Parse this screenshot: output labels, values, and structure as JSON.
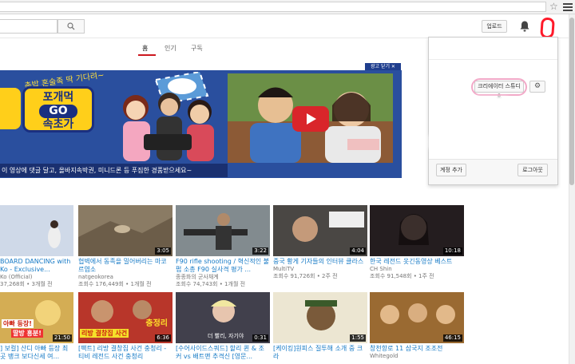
{
  "browser": {
    "star_icon": "star-icon",
    "menu_icon": "hamburger-menu-icon"
  },
  "masthead": {
    "search_icon": "🔍",
    "upload_label": "업로드",
    "notifications_icon": "bell-icon"
  },
  "tabs": [
    {
      "label": "홈",
      "active": true
    },
    {
      "label": "인기",
      "active": false
    },
    {
      "label": "구독",
      "active": false
    }
  ],
  "ad": {
    "close_label": "광고 닫기 ✕",
    "slogan": "촌밥 혼술족 딱 기다려~",
    "logo_line1": "포개먹",
    "logo_line2": "GO",
    "logo_line3": "속초가",
    "bottom_text": "이 영상에 댓글 달고, 올바지속박권, 미니드론 등 푸짐한 경품받으세요~",
    "accent_color": "#ffcf1a",
    "bg_color": "#2a4f9e"
  },
  "account_menu": {
    "creator_studio_label": "크리에이터 스튜디오",
    "add_account_label": "계정 추가",
    "logout_label": "로그아웃",
    "settings_icon": "gear-icon",
    "annotation_color": "#ff1a2a",
    "highlight_color": "#f2a9c8"
  },
  "videos_row1": [
    {
      "title": "BOARD DANCING with Ko - Exclusive...",
      "channel": "Ko (Official)",
      "meta": "37,268회 • 3개월 전",
      "duration": "",
      "bg": "#b7c5d8"
    },
    {
      "title": "협벽에서 동족을 밀어버리는 마코르염소",
      "channel": "natgeokorea",
      "meta": "조회수 176,449회 • 1개월 전",
      "duration": "3:05",
      "bg": "#7a6a55"
    },
    {
      "title": "F90 rifle shooting / 혁신적인 불펍 소총 F90 실사격 평가 ...",
      "channel": "종종화의 군사채계",
      "meta": "조회수 74,743회 • 1개월 전",
      "duration": "3:22",
      "bg": "#6f7a80"
    },
    {
      "title": "중국 황게 기자들의 인터뷰 클라스",
      "channel": "MultiTV",
      "meta": "조회수 91,726회 • 2주 전",
      "duration": "4:04",
      "bg": "#3c3a38"
    },
    {
      "title": "한국 레전드 옷긴동영상 베스트",
      "channel": "CH Shin",
      "meta": "조회수 91,548회 • 1주 전",
      "duration": "10:18",
      "bg": "#2b2326"
    }
  ],
  "videos_row2": [
    {
      "title": "] 보컬] 산디 아빠 등장 최 곳 뱅크 보다신세 여...",
      "channel": "",
      "meta": "",
      "duration": "21:50",
      "bg": "#c9a24a"
    },
    {
      "title": "[팩트] 리방 결창집 사건 충청리 - 티비 레전드 사건 충청리",
      "channel": "",
      "meta": "",
      "duration": "6:36",
      "bg": "#b32a22"
    },
    {
      "title": "[수어사이드스쿼드] 할리 퀸 & 조커 vs 배트맨 추격신 [영문...",
      "channel": "",
      "meta": "",
      "duration": "0:31",
      "bg": "#3b3a45"
    },
    {
      "title": "[케이킹]원피스 질투해 소개 중 크라",
      "channel": "",
      "meta": "",
      "duration": "1:55",
      "bg": "#e7e2d0"
    },
    {
      "title": "창천항로 11 삼국지 조조전",
      "channel": "Whitegold",
      "meta": "",
      "duration": "46:15",
      "bg": "#8a5a2a"
    }
  ],
  "thumb_overlays": {
    "row2_0_top": "아빠 등장!",
    "row2_0_bottom": "딸방 흥분!",
    "row2_1_top": "충정리",
    "row2_1_bottom": "리방 결창집 사건",
    "row2_2_caption": "더 빨리, 자기야"
  }
}
